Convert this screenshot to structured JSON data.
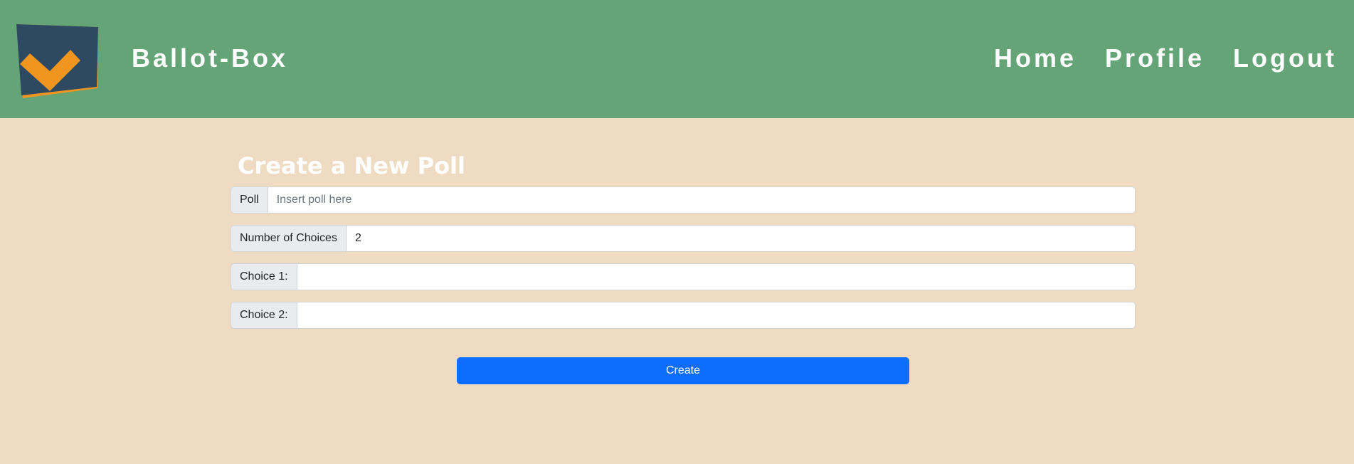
{
  "header": {
    "brand": "Ballot-Box",
    "logo_icon": "ballot-box-check-icon",
    "nav": [
      {
        "label": "Home"
      },
      {
        "label": "Profile"
      },
      {
        "label": "Logout"
      }
    ]
  },
  "form": {
    "title": "Create a New Poll",
    "fields": [
      {
        "label": "Poll",
        "value": "",
        "placeholder": "Insert poll here"
      },
      {
        "label": "Number of Choices",
        "value": "2",
        "placeholder": ""
      },
      {
        "label": "Choice 1:",
        "value": "",
        "placeholder": ""
      },
      {
        "label": "Choice 2:",
        "value": "",
        "placeholder": ""
      }
    ],
    "submit_label": "Create"
  },
  "colors": {
    "navbar": "#64a476",
    "background": "#eedbc2",
    "logo_box": "#2e4a62",
    "logo_check": "#f0951f",
    "button": "#0d6efd"
  }
}
